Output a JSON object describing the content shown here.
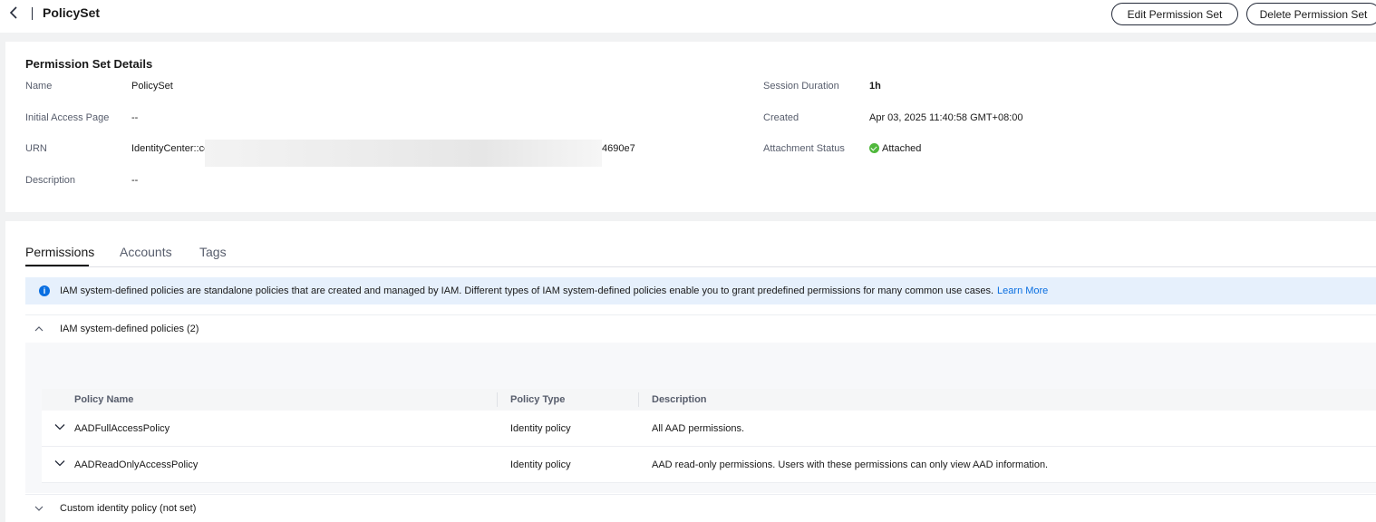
{
  "header": {
    "title": "PolicySet",
    "edit_label": "Edit Permission Set",
    "delete_label": "Delete Permission Set"
  },
  "details": {
    "title": "Permission Set Details",
    "name_label": "Name",
    "name_value": "PolicySet",
    "initial_page_label": "Initial Access Page",
    "initial_page_value": "--",
    "urn_label": "URN",
    "urn_prefix": "IdentityCenter::cc",
    "urn_suffix": "4690e7",
    "description_label": "Description",
    "description_value": "--",
    "session_label": "Session Duration",
    "session_value": "1h",
    "created_label": "Created",
    "created_value": "Apr 03, 2025 11:40:58 GMT+08:00",
    "status_label": "Attachment Status",
    "status_value": "Attached",
    "status_color": "#50b83c"
  },
  "tabs": [
    {
      "label": "Permissions"
    },
    {
      "label": "Accounts"
    },
    {
      "label": "Tags"
    }
  ],
  "banner": {
    "text": "IAM system-defined policies are standalone policies that are created and managed by IAM. Different types of IAM system-defined policies enable you to grant predefined permissions for many common use cases.",
    "link": "Learn More"
  },
  "system_section": {
    "title": "IAM system-defined policies (2)"
  },
  "table": {
    "columns": [
      "Policy Name",
      "Policy Type",
      "Description"
    ],
    "rows": [
      {
        "name": "AADFullAccessPolicy",
        "type": "Identity policy",
        "description": "All AAD permissions."
      },
      {
        "name": "AADReadOnlyAccessPolicy",
        "type": "Identity policy",
        "description": "AAD read-only permissions. Users with these permissions can only view AAD information."
      }
    ]
  },
  "custom_section": {
    "title": "Custom identity policy (not set)"
  },
  "colors": {
    "accent": "#0a6fe1",
    "banner_bg": "#e6f0fc"
  }
}
